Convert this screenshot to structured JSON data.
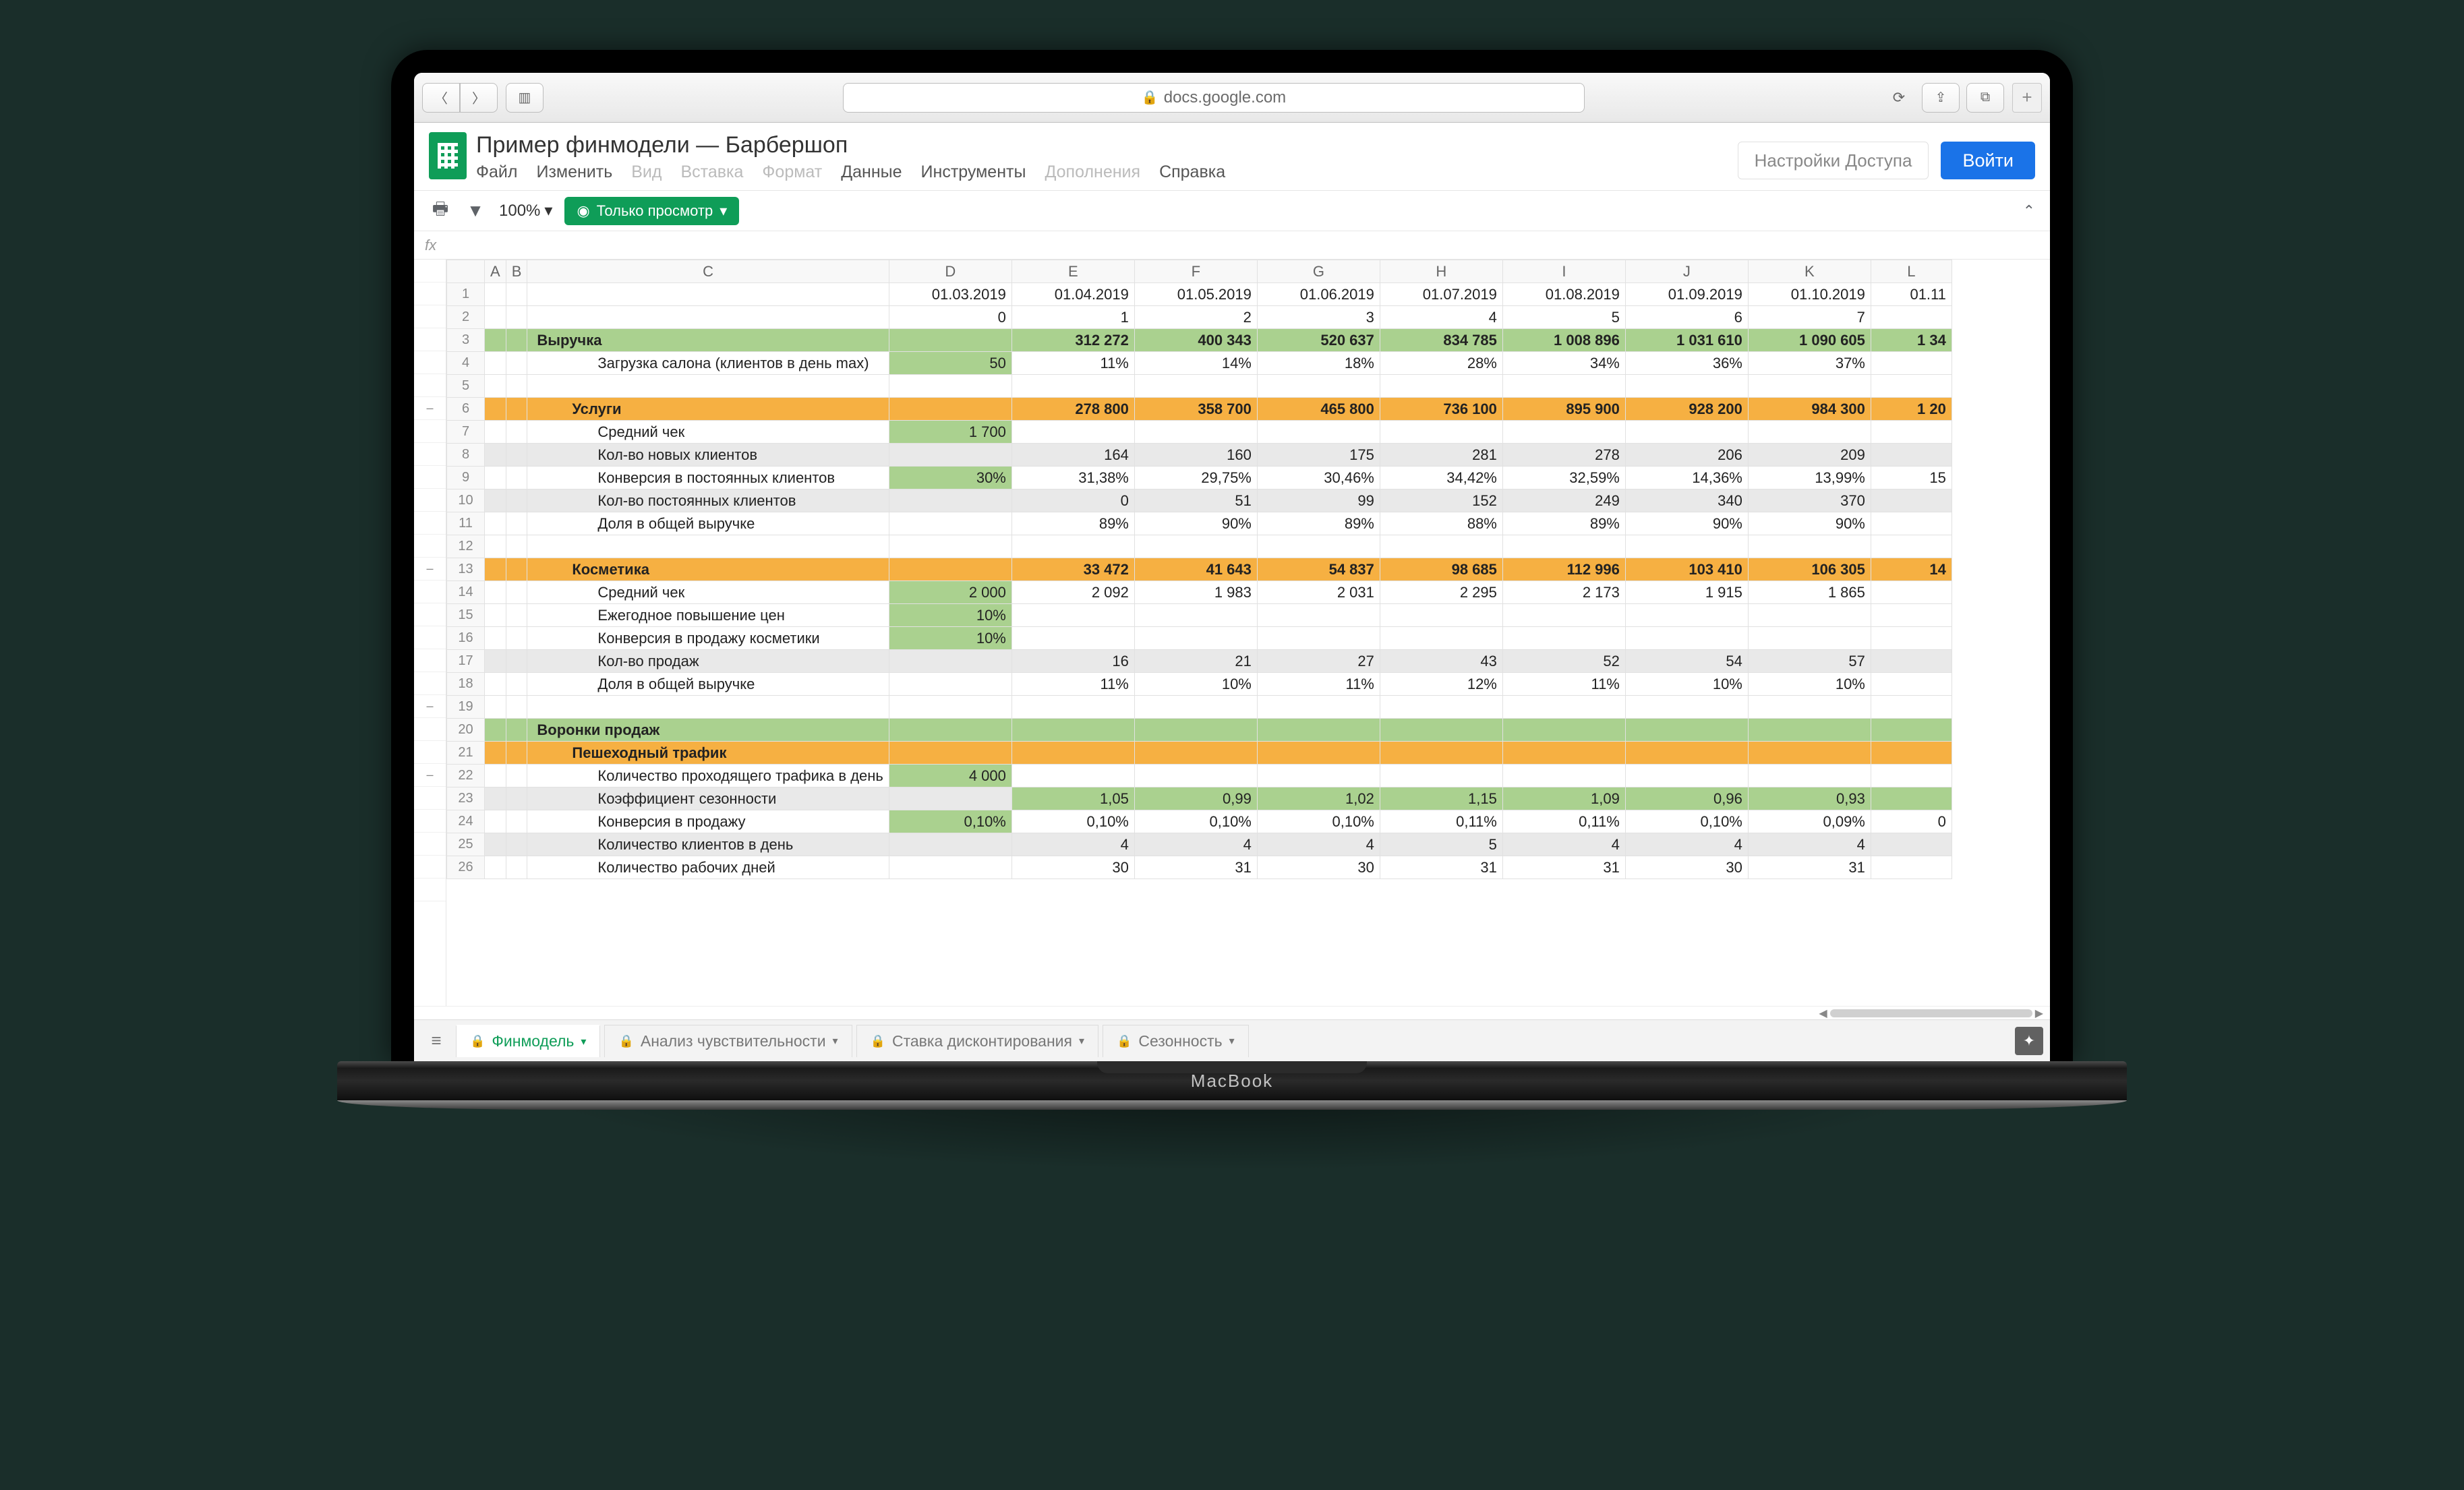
{
  "browser": {
    "url_host": "docs.google.com",
    "macbook_label": "MacBook"
  },
  "sheets": {
    "doc_title": "Пример финмодели — Барбершоп",
    "menus": [
      "Файл",
      "Изменить",
      "Вид",
      "Вставка",
      "Формат",
      "Данные",
      "Инструменты",
      "Дополнения",
      "Справка"
    ],
    "access_settings": "Настройки Доступа",
    "login": "Войти",
    "zoom": "100%",
    "view_only": "Только просмотр",
    "fx_label": "fx",
    "tabs": [
      {
        "label": "Финмодель",
        "active": true
      },
      {
        "label": "Анализ чувствительности",
        "active": false
      },
      {
        "label": "Ставка дисконтирования",
        "active": false
      },
      {
        "label": "Сезонность",
        "active": false
      }
    ]
  },
  "grid": {
    "col_headers": [
      "A",
      "B",
      "C",
      "D",
      "E",
      "F",
      "G",
      "H",
      "I",
      "J",
      "K",
      "L"
    ],
    "row_data": [
      {
        "n": 1,
        "type": "plain",
        "label": "",
        "cells": [
          "01.03.2019",
          "01.04.2019",
          "01.05.2019",
          "01.06.2019",
          "01.07.2019",
          "01.08.2019",
          "01.09.2019",
          "01.10.2019",
          "01.11"
        ]
      },
      {
        "n": 2,
        "type": "plain",
        "label": "",
        "cells": [
          "0",
          "1",
          "2",
          "3",
          "4",
          "5",
          "6",
          "7",
          ""
        ]
      },
      {
        "n": 3,
        "type": "green",
        "label": "Выручка",
        "indent": 0,
        "cells": [
          "",
          "312 272",
          "400 343",
          "520 637",
          "834 785",
          "1 008 896",
          "1 031 610",
          "1 090 605",
          "1 34"
        ]
      },
      {
        "n": 4,
        "type": "plain",
        "label": "Загрузка салона (клиентов в день max)",
        "indent": 2,
        "cells": [
          "50",
          "11%",
          "14%",
          "18%",
          "28%",
          "34%",
          "36%",
          "37%",
          ""
        ],
        "input_col": 0
      },
      {
        "n": 5,
        "type": "blank"
      },
      {
        "n": 6,
        "type": "orange",
        "label": "Услуги",
        "indent": 1,
        "cells": [
          "",
          "278 800",
          "358 700",
          "465 800",
          "736 100",
          "895 900",
          "928 200",
          "984 300",
          "1 20"
        ]
      },
      {
        "n": 7,
        "type": "plain",
        "label": "Средний чек",
        "indent": 2,
        "cells": [
          "1 700",
          "",
          "",
          "",
          "",
          "",
          "",
          "",
          ""
        ],
        "input_col": 0
      },
      {
        "n": 8,
        "type": "grey",
        "label": "Кол-во новых клиентов",
        "indent": 2,
        "cells": [
          "",
          "164",
          "160",
          "175",
          "281",
          "278",
          "206",
          "209",
          ""
        ]
      },
      {
        "n": 9,
        "type": "plain",
        "label": "Конверсия в постоянных клиентов",
        "indent": 2,
        "cells": [
          "30%",
          "31,38%",
          "29,75%",
          "30,46%",
          "34,42%",
          "32,59%",
          "14,36%",
          "13,99%",
          "15"
        ],
        "input_col": 0
      },
      {
        "n": 10,
        "type": "grey",
        "label": "Кол-во постоянных клиентов",
        "indent": 2,
        "cells": [
          "",
          "0",
          "51",
          "99",
          "152",
          "249",
          "340",
          "370",
          ""
        ]
      },
      {
        "n": 11,
        "type": "plain",
        "label": "Доля в общей выручке",
        "indent": 2,
        "cells": [
          "",
          "89%",
          "90%",
          "89%",
          "88%",
          "89%",
          "90%",
          "90%",
          ""
        ]
      },
      {
        "n": 12,
        "type": "blank"
      },
      {
        "n": 13,
        "type": "orange",
        "label": "Косметика",
        "indent": 1,
        "cells": [
          "",
          "33 472",
          "41 643",
          "54 837",
          "98 685",
          "112 996",
          "103 410",
          "106 305",
          "14"
        ]
      },
      {
        "n": 14,
        "type": "plain",
        "label": "Средний чек",
        "indent": 2,
        "cells": [
          "2 000",
          "2 092",
          "1 983",
          "2 031",
          "2 295",
          "2 173",
          "1 915",
          "1 865",
          ""
        ],
        "input_col": 0
      },
      {
        "n": 15,
        "type": "plain",
        "label": "Ежегодное повышение цен",
        "indent": 2,
        "cells": [
          "10%",
          "",
          "",
          "",
          "",
          "",
          "",
          "",
          ""
        ],
        "input_col": 0
      },
      {
        "n": 16,
        "type": "plain",
        "label": "Конверсия в продажу косметики",
        "indent": 2,
        "cells": [
          "10%",
          "",
          "",
          "",
          "",
          "",
          "",
          "",
          ""
        ],
        "input_col": 0
      },
      {
        "n": 17,
        "type": "grey",
        "label": "Кол-во продаж",
        "indent": 2,
        "cells": [
          "",
          "16",
          "21",
          "27",
          "43",
          "52",
          "54",
          "57",
          ""
        ]
      },
      {
        "n": 18,
        "type": "plain",
        "label": "Доля в общей выручке",
        "indent": 2,
        "cells": [
          "",
          "11%",
          "10%",
          "11%",
          "12%",
          "11%",
          "10%",
          "10%",
          ""
        ]
      },
      {
        "n": 19,
        "type": "blank"
      },
      {
        "n": 20,
        "type": "green",
        "label": "Воронки продаж",
        "indent": 0,
        "cells": [
          "",
          "",
          "",
          "",
          "",
          "",
          "",
          "",
          ""
        ]
      },
      {
        "n": 21,
        "type": "orange",
        "label": "Пешеходный трафик",
        "indent": 1,
        "cells": [
          "",
          "",
          "",
          "",
          "",
          "",
          "",
          "",
          ""
        ]
      },
      {
        "n": 22,
        "type": "plain",
        "label": "Количество проходящего трафика в день",
        "indent": 2,
        "cells": [
          "4 000",
          "",
          "",
          "",
          "",
          "",
          "",
          "",
          ""
        ],
        "input_col": 0
      },
      {
        "n": 23,
        "type": "grey",
        "label": "Коэффициент сезонности",
        "indent": 2,
        "cells": [
          "",
          "1,05",
          "0,99",
          "1,02",
          "1,15",
          "1,09",
          "0,96",
          "0,93",
          ""
        ],
        "grey_green": true
      },
      {
        "n": 24,
        "type": "plain",
        "label": "Конверсия в продажу",
        "indent": 2,
        "cells": [
          "0,10%",
          "0,10%",
          "0,10%",
          "0,10%",
          "0,11%",
          "0,11%",
          "0,10%",
          "0,09%",
          "0"
        ],
        "input_col": 0
      },
      {
        "n": 25,
        "type": "grey",
        "label": "Количество клиентов в день",
        "indent": 2,
        "cells": [
          "",
          "4",
          "4",
          "4",
          "5",
          "4",
          "4",
          "4",
          ""
        ]
      },
      {
        "n": 26,
        "type": "plain",
        "label": "Количество рабочих дней",
        "indent": 2,
        "cells": [
          "",
          "30",
          "31",
          "30",
          "31",
          "31",
          "30",
          "31",
          ""
        ]
      }
    ]
  }
}
